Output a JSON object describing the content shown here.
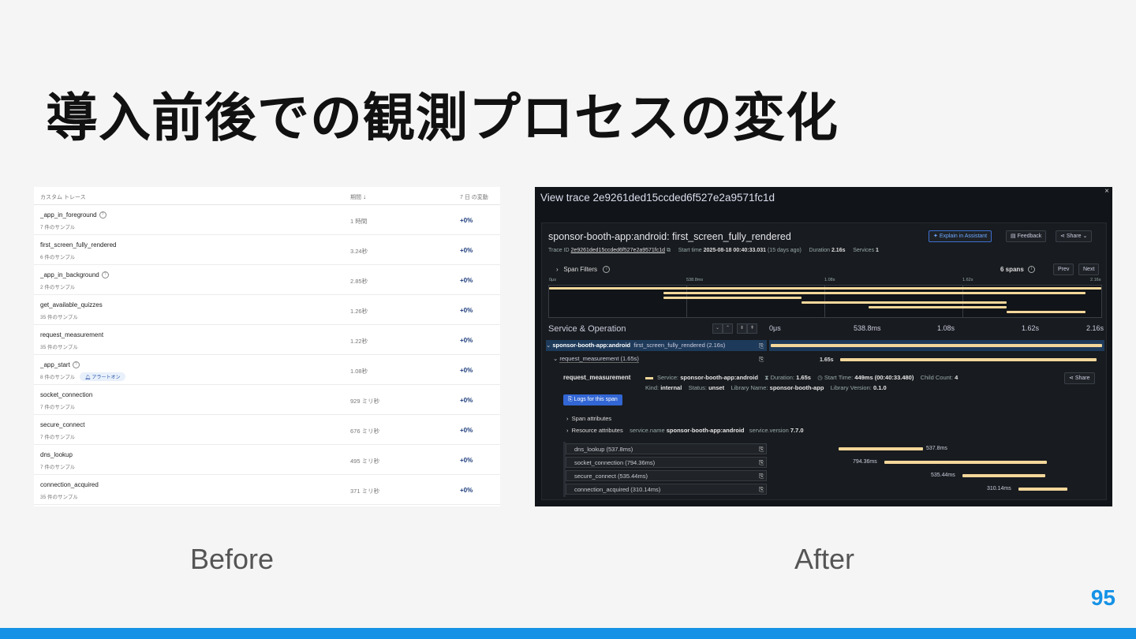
{
  "slide": {
    "title": "導入前後での観測プロセスの変化",
    "before_label": "Before",
    "after_label": "After",
    "page_number": "95",
    "accent_color": "#1592e6"
  },
  "before": {
    "columns": [
      "カスタム トレース",
      "期間",
      "7 日 の変動"
    ],
    "rows": [
      {
        "name": "_app_in_foreground",
        "samples": "7 件のサンプル",
        "duration": "1 時間",
        "change": "+0%",
        "help": true
      },
      {
        "name": "first_screen_fully_rendered",
        "samples": "6 件のサンプル",
        "duration": "3.24秒",
        "change": "+0%"
      },
      {
        "name": "_app_in_background",
        "samples": "2 件のサンプル",
        "duration": "2.85秒",
        "change": "+0%",
        "help": true
      },
      {
        "name": "get_available_quizzes",
        "samples": "35 件のサンプル",
        "duration": "1.26秒",
        "change": "+0%"
      },
      {
        "name": "request_measurement",
        "samples": "35 件のサンプル",
        "duration": "1.22秒",
        "change": "+0%"
      },
      {
        "name": "_app_start",
        "samples": "8 件のサンプル",
        "duration": "1.08秒",
        "change": "+0%",
        "help": true,
        "badge": "アラートオン"
      },
      {
        "name": "socket_connection",
        "samples": "7 件のサンプル",
        "duration": "929 ミリ秒",
        "change": "+0%"
      },
      {
        "name": "secure_connect",
        "samples": "7 件のサンプル",
        "duration": "676 ミリ秒",
        "change": "+0%"
      },
      {
        "name": "dns_lookup",
        "samples": "7 件のサンプル",
        "duration": "495 ミリ秒",
        "change": "+0%"
      },
      {
        "name": "connection_acquired",
        "samples": "35 件のサンプル",
        "duration": "371 ミリ秒",
        "change": "+0%"
      }
    ]
  },
  "after": {
    "window_title": "View trace 2e9261ded15ccded6f527e2a9571fc1d",
    "close": "×",
    "trace_name": "sponsor-booth-app:android: first_screen_fully_rendered",
    "trace_id_label": "Trace ID",
    "trace_id": "2e9261ded15ccded6f527e2a9571fc1d",
    "start_time_label": "Start time",
    "start_time": "2025-08-18 00:40:33.031",
    "start_time_ago": "(15 days ago)",
    "duration_label": "Duration",
    "duration": "2.16s",
    "services_label": "Services",
    "services": "1",
    "btn_explain": "Explain in Assistant",
    "btn_feedback": "Feedback",
    "btn_share": "Share",
    "span_filters": "Span Filters",
    "spans_count": "6 spans",
    "btn_prev": "Prev",
    "btn_next": "Next",
    "mini_ticks": [
      "0μs",
      "538.8ms",
      "1.08s",
      "1.62s",
      "2.16s"
    ],
    "service_operation": "Service & Operation",
    "ticks": [
      "0μs",
      "538.8ms",
      "1.08s",
      "1.62s",
      "2.16s"
    ],
    "root_service": "sponsor-booth-app:android",
    "root_op": "first_screen_fully_rendered (2.16s)",
    "child_span": "request_measurement (1.65s)",
    "child_dur": "1.65s",
    "detail": {
      "name": "request_measurement",
      "service_label": "Service:",
      "service": "sponsor-booth-app:android",
      "duration_label": "Duration:",
      "duration": "1.65s",
      "start_label": "Start Time:",
      "start": "449ms (00:40:33.480)",
      "child_count_label": "Child Count:",
      "child_count": "4",
      "kind_label": "Kind:",
      "kind": "internal",
      "status_label": "Status:",
      "status": "unset",
      "libname_label": "Library Name:",
      "libname": "sponsor-booth-app",
      "libver_label": "Library Version:",
      "libver": "0.1.0",
      "share": "Share",
      "logs_btn": "Logs for this span",
      "span_attrs": "Span attributes",
      "resource_attrs": "Resource attributes",
      "svc_name_key": "service.name",
      "svc_name_val": "sponsor-booth-app:android",
      "svc_ver_key": "service.version",
      "svc_ver_val": "7.7.0"
    },
    "children": [
      {
        "label": "dns_lookup (537.8ms)",
        "dur": "537.8ms"
      },
      {
        "label": "socket_connection (794.36ms)",
        "dur": "794.36ms"
      },
      {
        "label": "secure_connect (535.44ms)",
        "dur": "535.44ms"
      },
      {
        "label": "connection_acquired (310.14ms)",
        "dur": "310.14ms"
      }
    ]
  }
}
